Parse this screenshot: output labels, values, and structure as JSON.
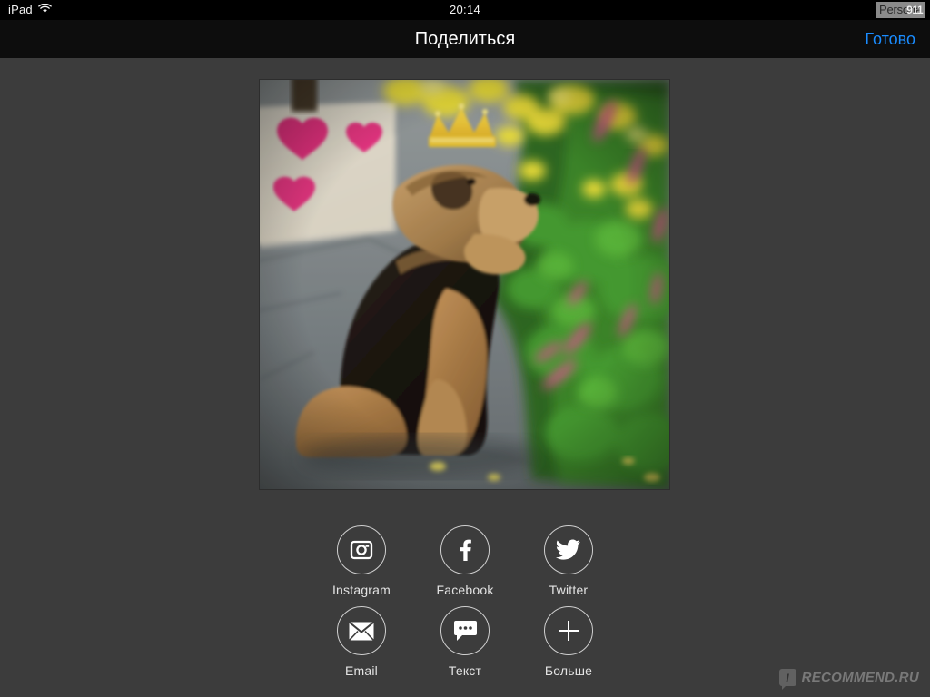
{
  "status_bar": {
    "device_label": "iPad",
    "wifi_icon": "wifi-icon",
    "time": "20:14",
    "battery_label": "Persona",
    "overlay_label": "911"
  },
  "nav_bar": {
    "title": "Поделиться",
    "done_label": "Готово"
  },
  "photo": {
    "alt": "Welsh terrier dog wearing a yellow paper crown sitting on a stone path beside flowering greenery, with pink hearts drawn on a white board behind",
    "subject": "dog-with-crown"
  },
  "share": {
    "rows": [
      [
        {
          "id": "instagram",
          "label": "Instagram",
          "icon": "instagram-camera-icon"
        },
        {
          "id": "facebook",
          "label": "Facebook",
          "icon": "facebook-f-icon"
        },
        {
          "id": "twitter",
          "label": "Twitter",
          "icon": "twitter-bird-icon"
        }
      ],
      [
        {
          "id": "email",
          "label": "Email",
          "icon": "envelope-icon"
        },
        {
          "id": "text",
          "label": "Текст",
          "icon": "speech-bubble-icon"
        },
        {
          "id": "more",
          "label": "Больше",
          "icon": "plus-icon"
        }
      ]
    ]
  },
  "watermark": {
    "badge_letter": "I",
    "text": "RECOMMEND.RU"
  },
  "colors": {
    "background": "#3c3c3c",
    "nav_background": "#0d0d0d",
    "status_background": "#000000",
    "accent_link": "#1a8cff",
    "icon_stroke": "#cfcfcf",
    "label_text": "#e3e3e3"
  }
}
